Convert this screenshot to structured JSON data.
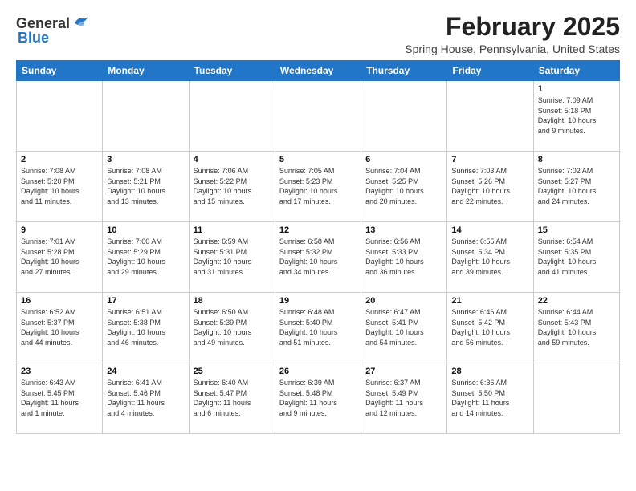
{
  "logo": {
    "general": "General",
    "blue": "Blue"
  },
  "header": {
    "month": "February 2025",
    "location": "Spring House, Pennsylvania, United States"
  },
  "weekdays": [
    "Sunday",
    "Monday",
    "Tuesday",
    "Wednesday",
    "Thursday",
    "Friday",
    "Saturday"
  ],
  "weeks": [
    [
      {
        "day": "",
        "info": ""
      },
      {
        "day": "",
        "info": ""
      },
      {
        "day": "",
        "info": ""
      },
      {
        "day": "",
        "info": ""
      },
      {
        "day": "",
        "info": ""
      },
      {
        "day": "",
        "info": ""
      },
      {
        "day": "1",
        "info": "Sunrise: 7:09 AM\nSunset: 5:18 PM\nDaylight: 10 hours\nand 9 minutes."
      }
    ],
    [
      {
        "day": "2",
        "info": "Sunrise: 7:08 AM\nSunset: 5:20 PM\nDaylight: 10 hours\nand 11 minutes."
      },
      {
        "day": "3",
        "info": "Sunrise: 7:08 AM\nSunset: 5:21 PM\nDaylight: 10 hours\nand 13 minutes."
      },
      {
        "day": "4",
        "info": "Sunrise: 7:06 AM\nSunset: 5:22 PM\nDaylight: 10 hours\nand 15 minutes."
      },
      {
        "day": "5",
        "info": "Sunrise: 7:05 AM\nSunset: 5:23 PM\nDaylight: 10 hours\nand 17 minutes."
      },
      {
        "day": "6",
        "info": "Sunrise: 7:04 AM\nSunset: 5:25 PM\nDaylight: 10 hours\nand 20 minutes."
      },
      {
        "day": "7",
        "info": "Sunrise: 7:03 AM\nSunset: 5:26 PM\nDaylight: 10 hours\nand 22 minutes."
      },
      {
        "day": "8",
        "info": "Sunrise: 7:02 AM\nSunset: 5:27 PM\nDaylight: 10 hours\nand 24 minutes."
      }
    ],
    [
      {
        "day": "9",
        "info": "Sunrise: 7:01 AM\nSunset: 5:28 PM\nDaylight: 10 hours\nand 27 minutes."
      },
      {
        "day": "10",
        "info": "Sunrise: 7:00 AM\nSunset: 5:29 PM\nDaylight: 10 hours\nand 29 minutes."
      },
      {
        "day": "11",
        "info": "Sunrise: 6:59 AM\nSunset: 5:31 PM\nDaylight: 10 hours\nand 31 minutes."
      },
      {
        "day": "12",
        "info": "Sunrise: 6:58 AM\nSunset: 5:32 PM\nDaylight: 10 hours\nand 34 minutes."
      },
      {
        "day": "13",
        "info": "Sunrise: 6:56 AM\nSunset: 5:33 PM\nDaylight: 10 hours\nand 36 minutes."
      },
      {
        "day": "14",
        "info": "Sunrise: 6:55 AM\nSunset: 5:34 PM\nDaylight: 10 hours\nand 39 minutes."
      },
      {
        "day": "15",
        "info": "Sunrise: 6:54 AM\nSunset: 5:35 PM\nDaylight: 10 hours\nand 41 minutes."
      }
    ],
    [
      {
        "day": "16",
        "info": "Sunrise: 6:52 AM\nSunset: 5:37 PM\nDaylight: 10 hours\nand 44 minutes."
      },
      {
        "day": "17",
        "info": "Sunrise: 6:51 AM\nSunset: 5:38 PM\nDaylight: 10 hours\nand 46 minutes."
      },
      {
        "day": "18",
        "info": "Sunrise: 6:50 AM\nSunset: 5:39 PM\nDaylight: 10 hours\nand 49 minutes."
      },
      {
        "day": "19",
        "info": "Sunrise: 6:48 AM\nSunset: 5:40 PM\nDaylight: 10 hours\nand 51 minutes."
      },
      {
        "day": "20",
        "info": "Sunrise: 6:47 AM\nSunset: 5:41 PM\nDaylight: 10 hours\nand 54 minutes."
      },
      {
        "day": "21",
        "info": "Sunrise: 6:46 AM\nSunset: 5:42 PM\nDaylight: 10 hours\nand 56 minutes."
      },
      {
        "day": "22",
        "info": "Sunrise: 6:44 AM\nSunset: 5:43 PM\nDaylight: 10 hours\nand 59 minutes."
      }
    ],
    [
      {
        "day": "23",
        "info": "Sunrise: 6:43 AM\nSunset: 5:45 PM\nDaylight: 11 hours\nand 1 minute."
      },
      {
        "day": "24",
        "info": "Sunrise: 6:41 AM\nSunset: 5:46 PM\nDaylight: 11 hours\nand 4 minutes."
      },
      {
        "day": "25",
        "info": "Sunrise: 6:40 AM\nSunset: 5:47 PM\nDaylight: 11 hours\nand 6 minutes."
      },
      {
        "day": "26",
        "info": "Sunrise: 6:39 AM\nSunset: 5:48 PM\nDaylight: 11 hours\nand 9 minutes."
      },
      {
        "day": "27",
        "info": "Sunrise: 6:37 AM\nSunset: 5:49 PM\nDaylight: 11 hours\nand 12 minutes."
      },
      {
        "day": "28",
        "info": "Sunrise: 6:36 AM\nSunset: 5:50 PM\nDaylight: 11 hours\nand 14 minutes."
      },
      {
        "day": "",
        "info": ""
      }
    ]
  ]
}
